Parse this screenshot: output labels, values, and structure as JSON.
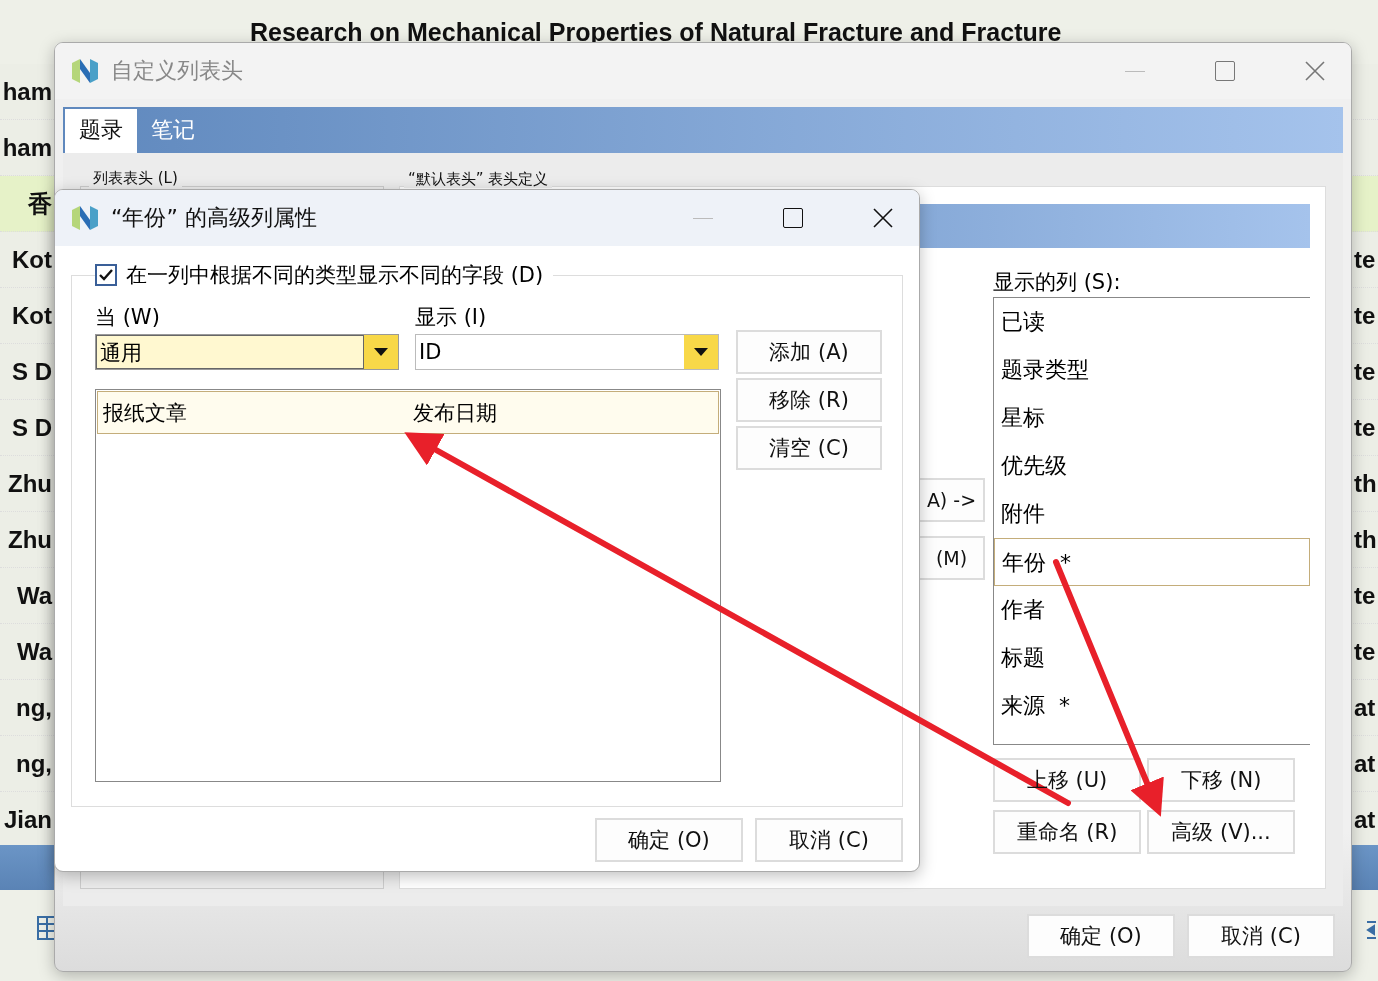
{
  "background": {
    "title": "Research on Mechanical Properties of Natural Fracture and Fracture",
    "rows": [
      {
        "left": "ham",
        "right": "",
        "highlight": false
      },
      {
        "left": "ham",
        "right": "",
        "highlight": false
      },
      {
        "left": "香",
        "right": "",
        "highlight": true
      },
      {
        "left": "Kot",
        "right": "te",
        "highlight": false
      },
      {
        "left": "Kot",
        "right": "te",
        "highlight": false
      },
      {
        "left": "S D",
        "right": "te",
        "highlight": false
      },
      {
        "left": "S D",
        "right": "te",
        "highlight": false
      },
      {
        "left": "Zhu",
        "right": "th",
        "highlight": false
      },
      {
        "left": "Zhu",
        "right": "th",
        "highlight": false
      },
      {
        "left": "Wa",
        "right": "te",
        "highlight": false
      },
      {
        "left": "Wa",
        "right": "te",
        "highlight": false
      },
      {
        "left": "ng,",
        "right": "at",
        "highlight": false
      },
      {
        "left": "ng,",
        "right": "at",
        "highlight": false
      },
      {
        "left": "Jian",
        "right": "at",
        "highlight": false
      }
    ]
  },
  "dialog": {
    "title": "自定义列表头",
    "tabs": [
      {
        "label": "题录",
        "selected": true
      },
      {
        "label": "笔记",
        "selected": false
      }
    ],
    "groups": [
      "列表表头 (L)",
      "“默认表头” 表头定义"
    ],
    "side_buttons": [
      "A) ->",
      "(M)"
    ],
    "shown_label": "显示的列 (S):",
    "columns": [
      {
        "label": "已读",
        "selected": false
      },
      {
        "label": "题录类型",
        "selected": false
      },
      {
        "label": "星标",
        "selected": false
      },
      {
        "label": "优先级",
        "selected": false
      },
      {
        "label": "附件",
        "selected": false
      },
      {
        "label": "年份  *",
        "selected": true
      },
      {
        "label": "作者",
        "selected": false
      },
      {
        "label": "标题",
        "selected": false
      },
      {
        "label": "来源  *",
        "selected": false
      }
    ],
    "list_buttons": [
      "上移 (U)",
      "下移 (N)",
      "重命名 (R)",
      "高级 (V)..."
    ],
    "buttons": [
      "确定 (O)",
      "取消 (C)"
    ]
  },
  "advanced": {
    "title": "“年份” 的高级列属性",
    "option": {
      "label": "在一列中根据不同的类型显示不同的字段 (D)",
      "checked": true
    },
    "when_label": "当 (W)",
    "when_value": "通用",
    "show_label": "显示 (I)",
    "show_value": "ID",
    "mappings": [
      {
        "type": "报纸文章",
        "field": "发布日期",
        "selected": true
      }
    ],
    "side_buttons": [
      "添加 (A)",
      "移除 (R)",
      "清空 (C)"
    ],
    "buttons": [
      "确定 (O)",
      "取消 (C)"
    ]
  }
}
